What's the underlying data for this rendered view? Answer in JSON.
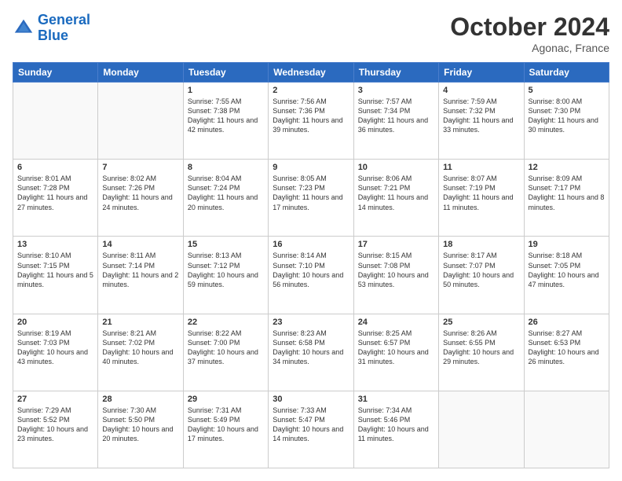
{
  "header": {
    "logo_line1": "General",
    "logo_line2": "Blue",
    "month": "October 2024",
    "location": "Agonac, France"
  },
  "days_of_week": [
    "Sunday",
    "Monday",
    "Tuesday",
    "Wednesday",
    "Thursday",
    "Friday",
    "Saturday"
  ],
  "weeks": [
    [
      {
        "day": "",
        "empty": true
      },
      {
        "day": "",
        "empty": true
      },
      {
        "day": "1",
        "sunrise": "Sunrise: 7:55 AM",
        "sunset": "Sunset: 7:38 PM",
        "daylight": "Daylight: 11 hours and 42 minutes."
      },
      {
        "day": "2",
        "sunrise": "Sunrise: 7:56 AM",
        "sunset": "Sunset: 7:36 PM",
        "daylight": "Daylight: 11 hours and 39 minutes."
      },
      {
        "day": "3",
        "sunrise": "Sunrise: 7:57 AM",
        "sunset": "Sunset: 7:34 PM",
        "daylight": "Daylight: 11 hours and 36 minutes."
      },
      {
        "day": "4",
        "sunrise": "Sunrise: 7:59 AM",
        "sunset": "Sunset: 7:32 PM",
        "daylight": "Daylight: 11 hours and 33 minutes."
      },
      {
        "day": "5",
        "sunrise": "Sunrise: 8:00 AM",
        "sunset": "Sunset: 7:30 PM",
        "daylight": "Daylight: 11 hours and 30 minutes."
      }
    ],
    [
      {
        "day": "6",
        "sunrise": "Sunrise: 8:01 AM",
        "sunset": "Sunset: 7:28 PM",
        "daylight": "Daylight: 11 hours and 27 minutes."
      },
      {
        "day": "7",
        "sunrise": "Sunrise: 8:02 AM",
        "sunset": "Sunset: 7:26 PM",
        "daylight": "Daylight: 11 hours and 24 minutes."
      },
      {
        "day": "8",
        "sunrise": "Sunrise: 8:04 AM",
        "sunset": "Sunset: 7:24 PM",
        "daylight": "Daylight: 11 hours and 20 minutes."
      },
      {
        "day": "9",
        "sunrise": "Sunrise: 8:05 AM",
        "sunset": "Sunset: 7:23 PM",
        "daylight": "Daylight: 11 hours and 17 minutes."
      },
      {
        "day": "10",
        "sunrise": "Sunrise: 8:06 AM",
        "sunset": "Sunset: 7:21 PM",
        "daylight": "Daylight: 11 hours and 14 minutes."
      },
      {
        "day": "11",
        "sunrise": "Sunrise: 8:07 AM",
        "sunset": "Sunset: 7:19 PM",
        "daylight": "Daylight: 11 hours and 11 minutes."
      },
      {
        "day": "12",
        "sunrise": "Sunrise: 8:09 AM",
        "sunset": "Sunset: 7:17 PM",
        "daylight": "Daylight: 11 hours and 8 minutes."
      }
    ],
    [
      {
        "day": "13",
        "sunrise": "Sunrise: 8:10 AM",
        "sunset": "Sunset: 7:15 PM",
        "daylight": "Daylight: 11 hours and 5 minutes."
      },
      {
        "day": "14",
        "sunrise": "Sunrise: 8:11 AM",
        "sunset": "Sunset: 7:14 PM",
        "daylight": "Daylight: 11 hours and 2 minutes."
      },
      {
        "day": "15",
        "sunrise": "Sunrise: 8:13 AM",
        "sunset": "Sunset: 7:12 PM",
        "daylight": "Daylight: 10 hours and 59 minutes."
      },
      {
        "day": "16",
        "sunrise": "Sunrise: 8:14 AM",
        "sunset": "Sunset: 7:10 PM",
        "daylight": "Daylight: 10 hours and 56 minutes."
      },
      {
        "day": "17",
        "sunrise": "Sunrise: 8:15 AM",
        "sunset": "Sunset: 7:08 PM",
        "daylight": "Daylight: 10 hours and 53 minutes."
      },
      {
        "day": "18",
        "sunrise": "Sunrise: 8:17 AM",
        "sunset": "Sunset: 7:07 PM",
        "daylight": "Daylight: 10 hours and 50 minutes."
      },
      {
        "day": "19",
        "sunrise": "Sunrise: 8:18 AM",
        "sunset": "Sunset: 7:05 PM",
        "daylight": "Daylight: 10 hours and 47 minutes."
      }
    ],
    [
      {
        "day": "20",
        "sunrise": "Sunrise: 8:19 AM",
        "sunset": "Sunset: 7:03 PM",
        "daylight": "Daylight: 10 hours and 43 minutes."
      },
      {
        "day": "21",
        "sunrise": "Sunrise: 8:21 AM",
        "sunset": "Sunset: 7:02 PM",
        "daylight": "Daylight: 10 hours and 40 minutes."
      },
      {
        "day": "22",
        "sunrise": "Sunrise: 8:22 AM",
        "sunset": "Sunset: 7:00 PM",
        "daylight": "Daylight: 10 hours and 37 minutes."
      },
      {
        "day": "23",
        "sunrise": "Sunrise: 8:23 AM",
        "sunset": "Sunset: 6:58 PM",
        "daylight": "Daylight: 10 hours and 34 minutes."
      },
      {
        "day": "24",
        "sunrise": "Sunrise: 8:25 AM",
        "sunset": "Sunset: 6:57 PM",
        "daylight": "Daylight: 10 hours and 31 minutes."
      },
      {
        "day": "25",
        "sunrise": "Sunrise: 8:26 AM",
        "sunset": "Sunset: 6:55 PM",
        "daylight": "Daylight: 10 hours and 29 minutes."
      },
      {
        "day": "26",
        "sunrise": "Sunrise: 8:27 AM",
        "sunset": "Sunset: 6:53 PM",
        "daylight": "Daylight: 10 hours and 26 minutes."
      }
    ],
    [
      {
        "day": "27",
        "sunrise": "Sunrise: 7:29 AM",
        "sunset": "Sunset: 5:52 PM",
        "daylight": "Daylight: 10 hours and 23 minutes."
      },
      {
        "day": "28",
        "sunrise": "Sunrise: 7:30 AM",
        "sunset": "Sunset: 5:50 PM",
        "daylight": "Daylight: 10 hours and 20 minutes."
      },
      {
        "day": "29",
        "sunrise": "Sunrise: 7:31 AM",
        "sunset": "Sunset: 5:49 PM",
        "daylight": "Daylight: 10 hours and 17 minutes."
      },
      {
        "day": "30",
        "sunrise": "Sunrise: 7:33 AM",
        "sunset": "Sunset: 5:47 PM",
        "daylight": "Daylight: 10 hours and 14 minutes."
      },
      {
        "day": "31",
        "sunrise": "Sunrise: 7:34 AM",
        "sunset": "Sunset: 5:46 PM",
        "daylight": "Daylight: 10 hours and 11 minutes."
      },
      {
        "day": "",
        "empty": true
      },
      {
        "day": "",
        "empty": true
      }
    ]
  ]
}
